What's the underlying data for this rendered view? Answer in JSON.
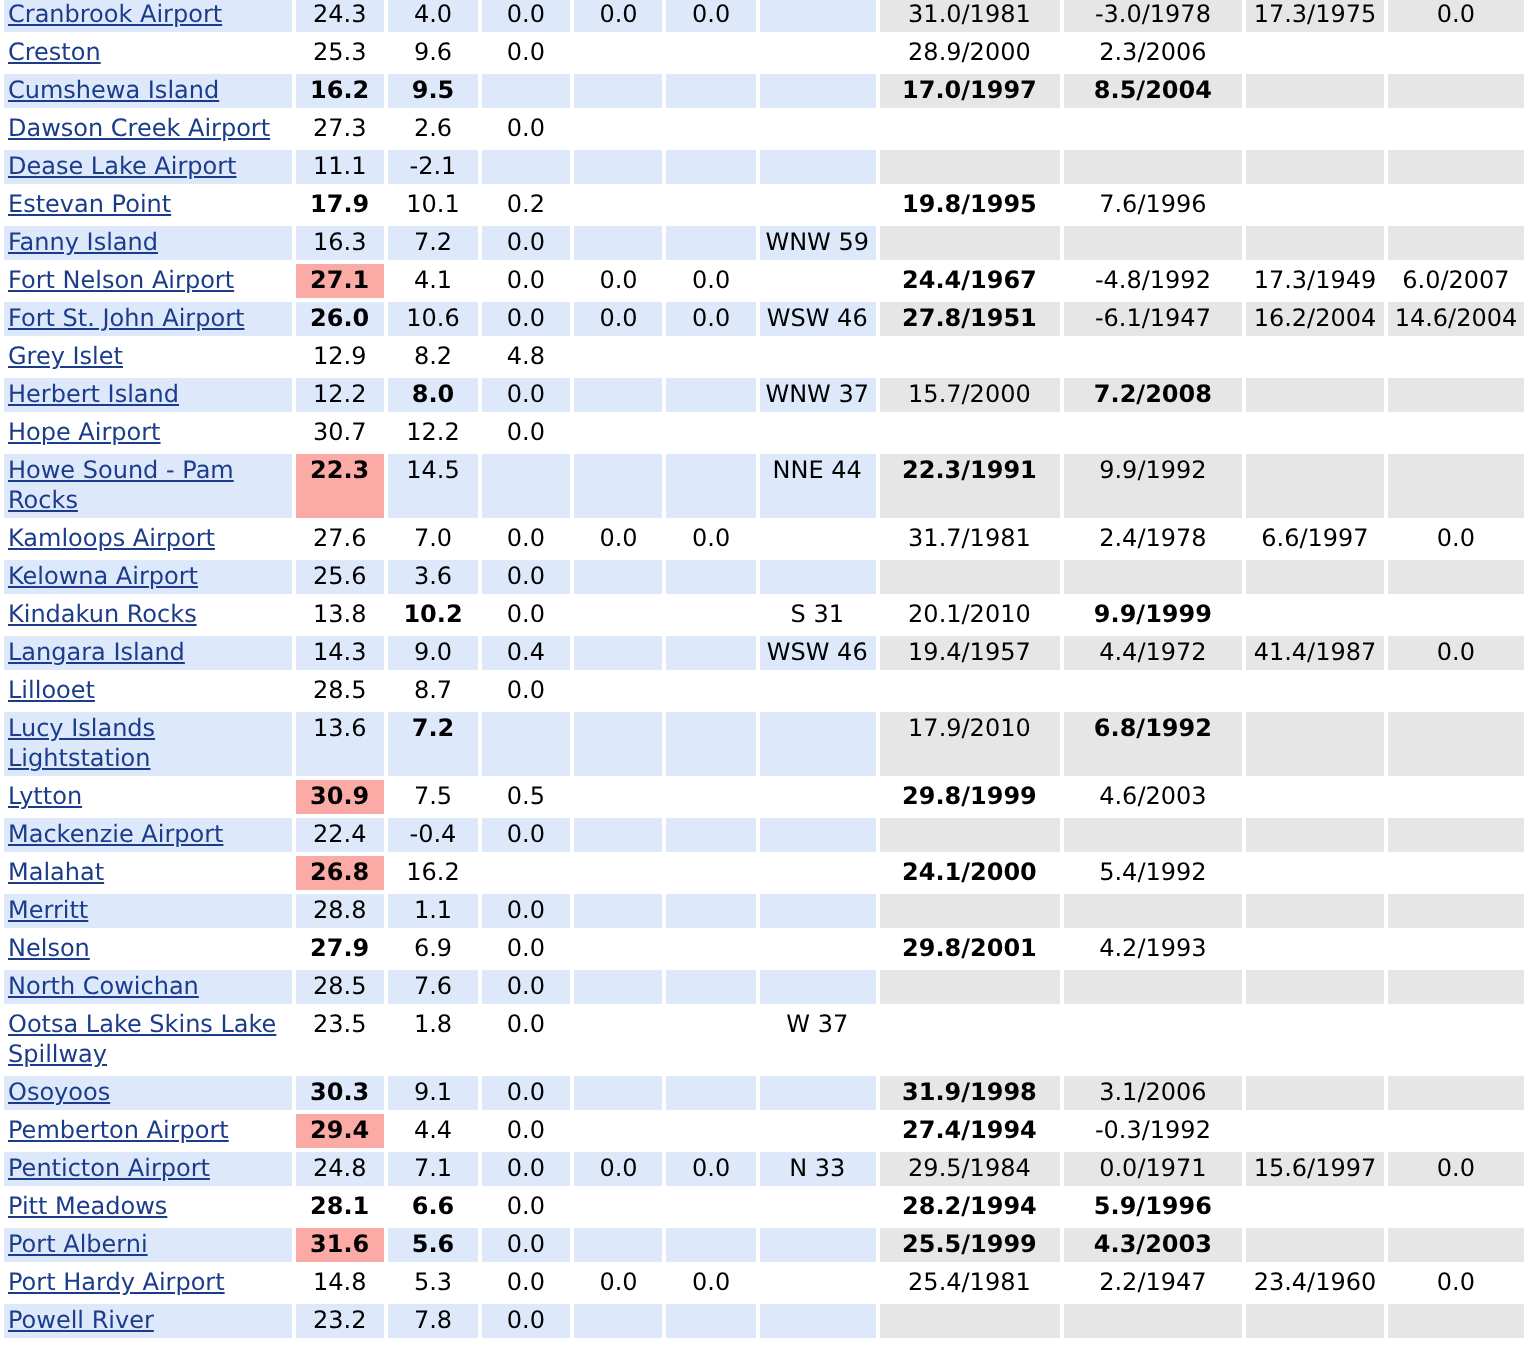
{
  "rows": [
    {
      "station": "Cranbrook Airport",
      "cells": [
        {
          "value": "24.3",
          "bold": false,
          "highlighted": false
        },
        {
          "value": "4.0",
          "bold": false
        },
        {
          "value": "0.0",
          "bold": false
        },
        {
          "value": "0.0",
          "bold": false
        },
        {
          "value": "0.0",
          "bold": false
        },
        null,
        {
          "value": "31.0/1981",
          "bold": false
        },
        {
          "value": "-3.0/1978",
          "bold": false
        },
        {
          "value": "17.3/1975",
          "bold": false
        },
        {
          "value": "0.0",
          "bold": false
        }
      ]
    },
    {
      "station": "Creston",
      "cells": [
        {
          "value": "25.3",
          "bold": false,
          "highlighted": false
        },
        {
          "value": "9.6",
          "bold": false
        },
        {
          "value": "0.0",
          "bold": false
        },
        null,
        null,
        null,
        {
          "value": "28.9/2000",
          "bold": false
        },
        {
          "value": "2.3/2006",
          "bold": false
        },
        null,
        null
      ]
    },
    {
      "station": "Cumshewa Island",
      "cells": [
        {
          "value": "16.2",
          "bold": true,
          "highlighted": false
        },
        {
          "value": "9.5",
          "bold": true
        },
        null,
        null,
        null,
        null,
        {
          "value": "17.0/1997",
          "bold": true
        },
        {
          "value": "8.5/2004",
          "bold": true
        },
        null,
        null
      ]
    },
    {
      "station": "Dawson Creek Airport",
      "cells": [
        {
          "value": "27.3",
          "bold": false,
          "highlighted": false
        },
        {
          "value": "2.6",
          "bold": false
        },
        {
          "value": "0.0",
          "bold": false
        },
        null,
        null,
        null,
        null,
        null,
        null,
        null
      ]
    },
    {
      "station": "Dease Lake Airport",
      "cells": [
        {
          "value": "11.1",
          "bold": false,
          "highlighted": false
        },
        {
          "value": "-2.1",
          "bold": false
        },
        null,
        null,
        null,
        null,
        null,
        null,
        null,
        null
      ]
    },
    {
      "station": "Estevan Point",
      "cells": [
        {
          "value": "17.9",
          "bold": true,
          "highlighted": false
        },
        {
          "value": "10.1",
          "bold": false
        },
        {
          "value": "0.2",
          "bold": false
        },
        null,
        null,
        null,
        {
          "value": "19.8/1995",
          "bold": true
        },
        {
          "value": "7.6/1996",
          "bold": false
        },
        null,
        null
      ]
    },
    {
      "station": "Fanny Island",
      "cells": [
        {
          "value": "16.3",
          "bold": false,
          "highlighted": false
        },
        {
          "value": "7.2",
          "bold": false
        },
        {
          "value": "0.0",
          "bold": false
        },
        null,
        null,
        {
          "value": "WNW 59",
          "bold": false
        },
        null,
        null,
        null,
        null
      ]
    },
    {
      "station": "Fort Nelson Airport",
      "cells": [
        {
          "value": "27.1",
          "bold": true,
          "highlighted": true
        },
        {
          "value": "4.1",
          "bold": false
        },
        {
          "value": "0.0",
          "bold": false
        },
        {
          "value": "0.0",
          "bold": false
        },
        {
          "value": "0.0",
          "bold": false
        },
        null,
        {
          "value": "24.4/1967",
          "bold": true
        },
        {
          "value": "-4.8/1992",
          "bold": false
        },
        {
          "value": "17.3/1949",
          "bold": false
        },
        {
          "value": "6.0/2007",
          "bold": false
        }
      ]
    },
    {
      "station": "Fort St. John Airport",
      "cells": [
        {
          "value": "26.0",
          "bold": true,
          "highlighted": false
        },
        {
          "value": "10.6",
          "bold": false
        },
        {
          "value": "0.0",
          "bold": false
        },
        {
          "value": "0.0",
          "bold": false
        },
        {
          "value": "0.0",
          "bold": false
        },
        {
          "value": "WSW 46",
          "bold": false
        },
        {
          "value": "27.8/1951",
          "bold": true
        },
        {
          "value": "-6.1/1947",
          "bold": false
        },
        {
          "value": "16.2/2004",
          "bold": false
        },
        {
          "value": "14.6/2004",
          "bold": false
        }
      ]
    },
    {
      "station": "Grey Islet",
      "cells": [
        {
          "value": "12.9",
          "bold": false,
          "highlighted": false
        },
        {
          "value": "8.2",
          "bold": false
        },
        {
          "value": "4.8",
          "bold": false
        },
        null,
        null,
        null,
        null,
        null,
        null,
        null
      ]
    },
    {
      "station": "Herbert Island",
      "cells": [
        {
          "value": "12.2",
          "bold": false,
          "highlighted": false
        },
        {
          "value": "8.0",
          "bold": true
        },
        {
          "value": "0.0",
          "bold": false
        },
        null,
        null,
        {
          "value": "WNW 37",
          "bold": false
        },
        {
          "value": "15.7/2000",
          "bold": false
        },
        {
          "value": "7.2/2008",
          "bold": true
        },
        null,
        null
      ]
    },
    {
      "station": "Hope Airport",
      "cells": [
        {
          "value": "30.7",
          "bold": false,
          "highlighted": false
        },
        {
          "value": "12.2",
          "bold": false
        },
        {
          "value": "0.0",
          "bold": false
        },
        null,
        null,
        null,
        null,
        null,
        null,
        null
      ]
    },
    {
      "station": "Howe Sound - Pam Rocks",
      "cells": [
        {
          "value": "22.3",
          "bold": true,
          "highlighted": true
        },
        {
          "value": "14.5",
          "bold": false
        },
        null,
        null,
        null,
        {
          "value": "NNE 44",
          "bold": false
        },
        {
          "value": "22.3/1991",
          "bold": true
        },
        {
          "value": "9.9/1992",
          "bold": false
        },
        null,
        null
      ]
    },
    {
      "station": "Kamloops Airport",
      "cells": [
        {
          "value": "27.6",
          "bold": false,
          "highlighted": false
        },
        {
          "value": "7.0",
          "bold": false
        },
        {
          "value": "0.0",
          "bold": false
        },
        {
          "value": "0.0",
          "bold": false
        },
        {
          "value": "0.0",
          "bold": false
        },
        null,
        {
          "value": "31.7/1981",
          "bold": false
        },
        {
          "value": "2.4/1978",
          "bold": false
        },
        {
          "value": "6.6/1997",
          "bold": false
        },
        {
          "value": "0.0",
          "bold": false
        }
      ]
    },
    {
      "station": "Kelowna Airport",
      "cells": [
        {
          "value": "25.6",
          "bold": false,
          "highlighted": false
        },
        {
          "value": "3.6",
          "bold": false
        },
        {
          "value": "0.0",
          "bold": false
        },
        null,
        null,
        null,
        null,
        null,
        null,
        null
      ]
    },
    {
      "station": "Kindakun Rocks",
      "cells": [
        {
          "value": "13.8",
          "bold": false,
          "highlighted": false
        },
        {
          "value": "10.2",
          "bold": true
        },
        {
          "value": "0.0",
          "bold": false
        },
        null,
        null,
        {
          "value": "S 31",
          "bold": false
        },
        {
          "value": "20.1/2010",
          "bold": false
        },
        {
          "value": "9.9/1999",
          "bold": true
        },
        null,
        null
      ]
    },
    {
      "station": "Langara Island",
      "cells": [
        {
          "value": "14.3",
          "bold": false,
          "highlighted": false
        },
        {
          "value": "9.0",
          "bold": false
        },
        {
          "value": "0.4",
          "bold": false
        },
        null,
        null,
        {
          "value": "WSW 46",
          "bold": false
        },
        {
          "value": "19.4/1957",
          "bold": false
        },
        {
          "value": "4.4/1972",
          "bold": false
        },
        {
          "value": "41.4/1987",
          "bold": false
        },
        {
          "value": "0.0",
          "bold": false
        }
      ]
    },
    {
      "station": "Lillooet",
      "cells": [
        {
          "value": "28.5",
          "bold": false,
          "highlighted": false
        },
        {
          "value": "8.7",
          "bold": false
        },
        {
          "value": "0.0",
          "bold": false
        },
        null,
        null,
        null,
        null,
        null,
        null,
        null
      ]
    },
    {
      "station": "Lucy Islands Lightstation",
      "cells": [
        {
          "value": "13.6",
          "bold": false,
          "highlighted": false
        },
        {
          "value": "7.2",
          "bold": true
        },
        null,
        null,
        null,
        null,
        {
          "value": "17.9/2010",
          "bold": false
        },
        {
          "value": "6.8/1992",
          "bold": true
        },
        null,
        null
      ]
    },
    {
      "station": "Lytton",
      "cells": [
        {
          "value": "30.9",
          "bold": true,
          "highlighted": true
        },
        {
          "value": "7.5",
          "bold": false
        },
        {
          "value": "0.5",
          "bold": false
        },
        null,
        null,
        null,
        {
          "value": "29.8/1999",
          "bold": true
        },
        {
          "value": "4.6/2003",
          "bold": false
        },
        null,
        null
      ]
    },
    {
      "station": "Mackenzie Airport",
      "cells": [
        {
          "value": "22.4",
          "bold": false,
          "highlighted": false
        },
        {
          "value": "-0.4",
          "bold": false
        },
        {
          "value": "0.0",
          "bold": false
        },
        null,
        null,
        null,
        null,
        null,
        null,
        null
      ]
    },
    {
      "station": "Malahat",
      "cells": [
        {
          "value": "26.8",
          "bold": true,
          "highlighted": true
        },
        {
          "value": "16.2",
          "bold": false
        },
        null,
        null,
        null,
        null,
        {
          "value": "24.1/2000",
          "bold": true
        },
        {
          "value": "5.4/1992",
          "bold": false
        },
        null,
        null
      ]
    },
    {
      "station": "Merritt",
      "cells": [
        {
          "value": "28.8",
          "bold": false,
          "highlighted": false
        },
        {
          "value": "1.1",
          "bold": false
        },
        {
          "value": "0.0",
          "bold": false
        },
        null,
        null,
        null,
        null,
        null,
        null,
        null
      ]
    },
    {
      "station": "Nelson",
      "cells": [
        {
          "value": "27.9",
          "bold": true,
          "highlighted": false
        },
        {
          "value": "6.9",
          "bold": false
        },
        {
          "value": "0.0",
          "bold": false
        },
        null,
        null,
        null,
        {
          "value": "29.8/2001",
          "bold": true
        },
        {
          "value": "4.2/1993",
          "bold": false
        },
        null,
        null
      ]
    },
    {
      "station": "North Cowichan",
      "cells": [
        {
          "value": "28.5",
          "bold": false,
          "highlighted": false
        },
        {
          "value": "7.6",
          "bold": false
        },
        {
          "value": "0.0",
          "bold": false
        },
        null,
        null,
        null,
        null,
        null,
        null,
        null
      ]
    },
    {
      "station": "Ootsa Lake Skins Lake Spillway",
      "cells": [
        {
          "value": "23.5",
          "bold": false,
          "highlighted": false
        },
        {
          "value": "1.8",
          "bold": false
        },
        {
          "value": "0.0",
          "bold": false
        },
        null,
        null,
        {
          "value": "W 37",
          "bold": false
        },
        null,
        null,
        null,
        null
      ]
    },
    {
      "station": "Osoyoos",
      "cells": [
        {
          "value": "30.3",
          "bold": true,
          "highlighted": false
        },
        {
          "value": "9.1",
          "bold": false
        },
        {
          "value": "0.0",
          "bold": false
        },
        null,
        null,
        null,
        {
          "value": "31.9/1998",
          "bold": true
        },
        {
          "value": "3.1/2006",
          "bold": false
        },
        null,
        null
      ]
    },
    {
      "station": "Pemberton Airport",
      "cells": [
        {
          "value": "29.4",
          "bold": true,
          "highlighted": true
        },
        {
          "value": "4.4",
          "bold": false
        },
        {
          "value": "0.0",
          "bold": false
        },
        null,
        null,
        null,
        {
          "value": "27.4/1994",
          "bold": true
        },
        {
          "value": "-0.3/1992",
          "bold": false
        },
        null,
        null
      ]
    },
    {
      "station": "Penticton Airport",
      "cells": [
        {
          "value": "24.8",
          "bold": false,
          "highlighted": false
        },
        {
          "value": "7.1",
          "bold": false
        },
        {
          "value": "0.0",
          "bold": false
        },
        {
          "value": "0.0",
          "bold": false
        },
        {
          "value": "0.0",
          "bold": false
        },
        {
          "value": "N 33",
          "bold": false
        },
        {
          "value": "29.5/1984",
          "bold": false
        },
        {
          "value": "0.0/1971",
          "bold": false
        },
        {
          "value": "15.6/1997",
          "bold": false
        },
        {
          "value": "0.0",
          "bold": false
        }
      ]
    },
    {
      "station": "Pitt Meadows",
      "cells": [
        {
          "value": "28.1",
          "bold": true,
          "highlighted": false
        },
        {
          "value": "6.6",
          "bold": true
        },
        {
          "value": "0.0",
          "bold": false
        },
        null,
        null,
        null,
        {
          "value": "28.2/1994",
          "bold": true
        },
        {
          "value": "5.9/1996",
          "bold": true
        },
        null,
        null
      ]
    },
    {
      "station": "Port Alberni",
      "cells": [
        {
          "value": "31.6",
          "bold": true,
          "highlighted": true
        },
        {
          "value": "5.6",
          "bold": true
        },
        {
          "value": "0.0",
          "bold": false
        },
        null,
        null,
        null,
        {
          "value": "25.5/1999",
          "bold": true
        },
        {
          "value": "4.3/2003",
          "bold": true
        },
        null,
        null
      ]
    },
    {
      "station": "Port Hardy Airport",
      "cells": [
        {
          "value": "14.8",
          "bold": false,
          "highlighted": false
        },
        {
          "value": "5.3",
          "bold": false
        },
        {
          "value": "0.0",
          "bold": false
        },
        {
          "value": "0.0",
          "bold": false
        },
        {
          "value": "0.0",
          "bold": false
        },
        null,
        {
          "value": "25.4/1981",
          "bold": false
        },
        {
          "value": "2.2/1947",
          "bold": false
        },
        {
          "value": "23.4/1960",
          "bold": false
        },
        {
          "value": "0.0",
          "bold": false
        }
      ]
    },
    {
      "station": "Powell River",
      "cells": [
        {
          "value": "23.2",
          "bold": false,
          "highlighted": false
        },
        {
          "value": "7.8",
          "bold": false
        },
        {
          "value": "0.0",
          "bold": false
        },
        null,
        null,
        null,
        null,
        null,
        null,
        null
      ]
    }
  ]
}
